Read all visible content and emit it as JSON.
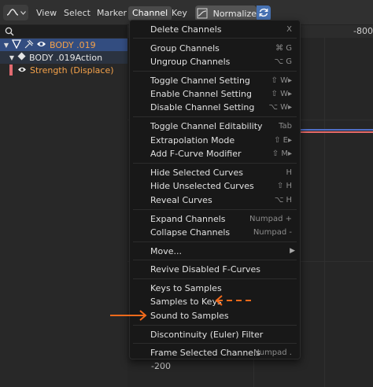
{
  "header": {
    "menus": [
      "View",
      "Select",
      "Marker",
      "Channel",
      "Key"
    ],
    "active_menu": "Channel",
    "normalize_label": "Normalize"
  },
  "channels": {
    "object_label": "BODY .019",
    "action_label": "BODY .019Action",
    "fcurve_label": "Strength (Displace)"
  },
  "graph": {
    "ruler_value": "-800",
    "bottom_value": "-200",
    "curve_colors": [
      "#4f6fc8",
      "#e56a6a"
    ]
  },
  "menu": {
    "items": [
      {
        "label": "Delete Channels",
        "shortcut": "X"
      },
      {
        "label": "Group Channels",
        "shortcut": "⌘ G"
      },
      {
        "label": "Ungroup Channels",
        "shortcut": "⌥ G"
      },
      {
        "label": "Toggle Channel Setting",
        "shortcut": "⇧ W▸"
      },
      {
        "label": "Enable Channel Setting",
        "shortcut": "⇧ W▸"
      },
      {
        "label": "Disable Channel Setting",
        "shortcut": "⌥ W▸"
      },
      {
        "label": "Toggle Channel Editability",
        "shortcut": "Tab"
      },
      {
        "label": "Extrapolation Mode",
        "shortcut": "⇧ E▸"
      },
      {
        "label": "Add F-Curve Modifier",
        "shortcut": "⇧ M▸"
      },
      {
        "label": "Hide Selected Curves",
        "shortcut": "H"
      },
      {
        "label": "Hide Unselected Curves",
        "shortcut": "⇧ H"
      },
      {
        "label": "Reveal Curves",
        "shortcut": "⌥ H"
      },
      {
        "label": "Expand Channels",
        "shortcut": "Numpad +"
      },
      {
        "label": "Collapse Channels",
        "shortcut": "Numpad -"
      },
      {
        "label": "Move...",
        "shortcut": ""
      },
      {
        "label": "Revive Disabled F-Curves",
        "shortcut": ""
      },
      {
        "label": "Keys to Samples",
        "shortcut": ""
      },
      {
        "label": "Samples to Keys",
        "shortcut": ""
      },
      {
        "label": "Sound to Samples",
        "shortcut": ""
      },
      {
        "label": "Discontinuity (Euler) Filter",
        "shortcut": ""
      },
      {
        "label": "Frame Selected Channels",
        "shortcut": "Numpad ."
      }
    ]
  },
  "annotation_color": "#f26a1b"
}
